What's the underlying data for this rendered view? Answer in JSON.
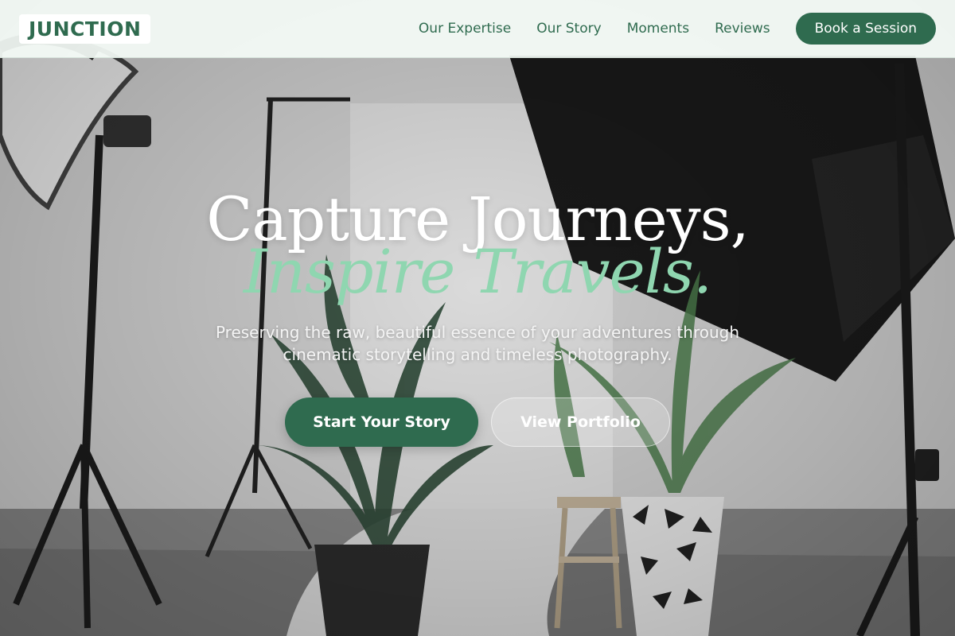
{
  "brand": {
    "logo_text": "JUNCTION"
  },
  "nav": {
    "links": [
      {
        "label": "Our Expertise"
      },
      {
        "label": "Our Story"
      },
      {
        "label": "Moments"
      },
      {
        "label": "Reviews"
      }
    ],
    "cta_label": "Book a Session"
  },
  "hero": {
    "headline_line1": "Capture Journeys,",
    "headline_line2": "Inspire Travels.",
    "subtitle": "Preserving the raw, beautiful essence of your adventures through cinematic storytelling and timeless photography.",
    "primary_cta": "Start Your Story",
    "secondary_cta": "View Portfolio",
    "background_image": "photography-studio-photo"
  },
  "colors": {
    "brand_green": "#2f6b4f",
    "accent_mint": "#8fd6b0",
    "nav_bg": "#f4fbf6"
  }
}
